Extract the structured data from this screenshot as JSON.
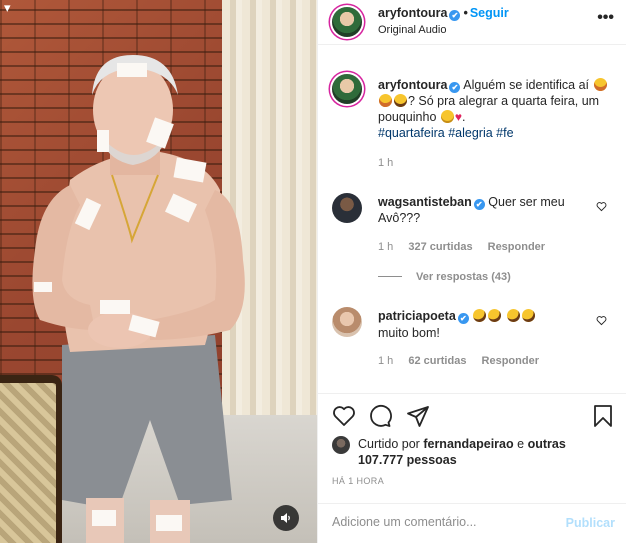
{
  "header": {
    "username": "aryfontoura",
    "verified_mark": "✔",
    "separator": "•",
    "follow_label": "Seguir",
    "subtitle": "Original Audio",
    "more_icon": "more-horizontal-icon"
  },
  "media": {
    "sound_icon": "volume-icon",
    "back_icon": "chevron-down-icon"
  },
  "caption": {
    "username": "aryfontoura",
    "text_part1": "Alguém se identifica aí",
    "text_part2": "? Só pra alegrar a quarta feira, um pouquinho",
    "hashtags": [
      "#quartafeira",
      "#alegria",
      "#fe"
    ],
    "time": "1 h"
  },
  "comments": [
    {
      "username": "wagsantisteban",
      "text": "Quer ser meu Avô???",
      "time": "1 h",
      "likes": "327 curtidas",
      "reply_label": "Responder",
      "view_replies": "Ver respostas (43)"
    },
    {
      "username": "patriciapoeta",
      "text": "muito bom!",
      "time": "1 h",
      "likes": "62 curtidas",
      "reply_label": "Responder"
    }
  ],
  "actions": {
    "like_icon": "heart-icon",
    "comment_icon": "comment-icon",
    "share_icon": "send-icon",
    "save_icon": "bookmark-icon"
  },
  "likes": {
    "prefix": "Curtido por",
    "user": "fernandapeirao",
    "conj": "e",
    "others": "outras 107.777 pessoas"
  },
  "post_time": "HÁ 1 HORA",
  "add_comment": {
    "placeholder": "Adicione um comentário...",
    "publish_label": "Publicar"
  },
  "colors": {
    "accent": "#0095f6",
    "verified": "#3897f0",
    "hashtag": "#00376b",
    "muted": "#8e8e8e",
    "publish_disabled": "#b2dffc"
  }
}
